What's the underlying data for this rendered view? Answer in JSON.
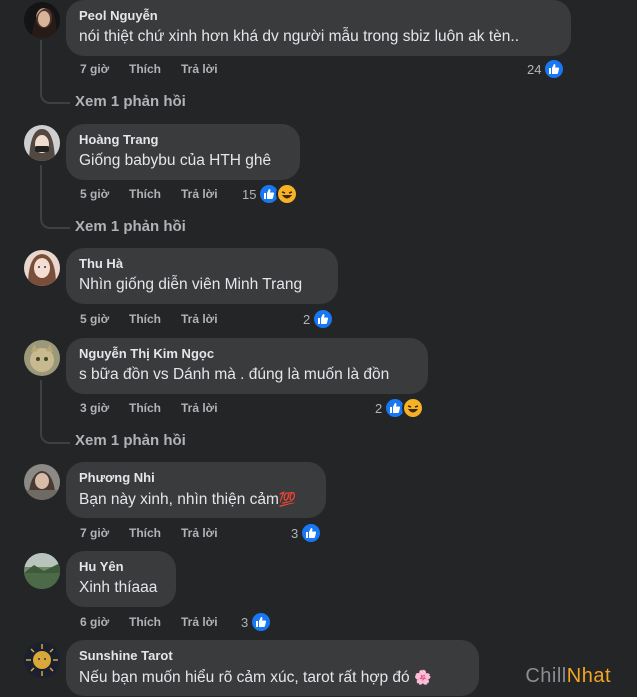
{
  "colors": {
    "background": "#242526",
    "bubble": "#3a3b3c",
    "like": "#1877f2",
    "haha": "#f7b125",
    "meta": "#b0b3b8"
  },
  "comments": [
    {
      "author": "Peol Nguyễn",
      "text": "nói thiệt chứ xinh hơn khá dv người mẫu trong sbiz luôn ak tèn..",
      "time": "7 giờ",
      "like": "Thích",
      "reply": "Trả lời",
      "count": "24",
      "reactions": [
        "like-icon"
      ],
      "view_replies": "Xem 1 phản hồi"
    },
    {
      "author": "Hoàng Trang",
      "text": "Giống babybu của HTH ghê",
      "time": "5 giờ",
      "like": "Thích",
      "reply": "Trả lời",
      "count": "15",
      "reactions": [
        "like-icon",
        "haha-icon"
      ],
      "view_replies": "Xem 1 phản hồi"
    },
    {
      "author": "Thu Hà",
      "text": "Nhìn giống diễn viên Minh Trang",
      "time": "5 giờ",
      "like": "Thích",
      "reply": "Trả lời",
      "count": "2",
      "reactions": [
        "like-icon"
      ]
    },
    {
      "author": "Nguyễn Thị Kim Ngọc",
      "text": "s bữa đồn vs Dánh mà . đúng là muốn là đồn",
      "time": "3 giờ",
      "like": "Thích",
      "reply": "Trả lời",
      "count": "2",
      "reactions": [
        "like-icon",
        "haha-icon"
      ],
      "view_replies": "Xem 1 phản hồi"
    },
    {
      "author": "Phương Nhi",
      "text": "Bạn này xinh, nhìn thiện cảm",
      "emoji": "💯",
      "time": "7 giờ",
      "like": "Thích",
      "reply": "Trả lời",
      "count": "3",
      "reactions": [
        "like-icon"
      ]
    },
    {
      "author": "Hu Yên",
      "text": "Xinh thíaaa",
      "time": "6 giờ",
      "like": "Thích",
      "reply": "Trả lời",
      "count": "3",
      "reactions": [
        "like-icon"
      ]
    },
    {
      "author": "Sunshine Tarot",
      "text": "Nếu bạn muốn hiểu rõ cảm xúc, tarot rất hợp đó",
      "emoji": "🌸"
    }
  ],
  "watermark": {
    "part1": "Chill",
    "part2": "Nhat"
  }
}
